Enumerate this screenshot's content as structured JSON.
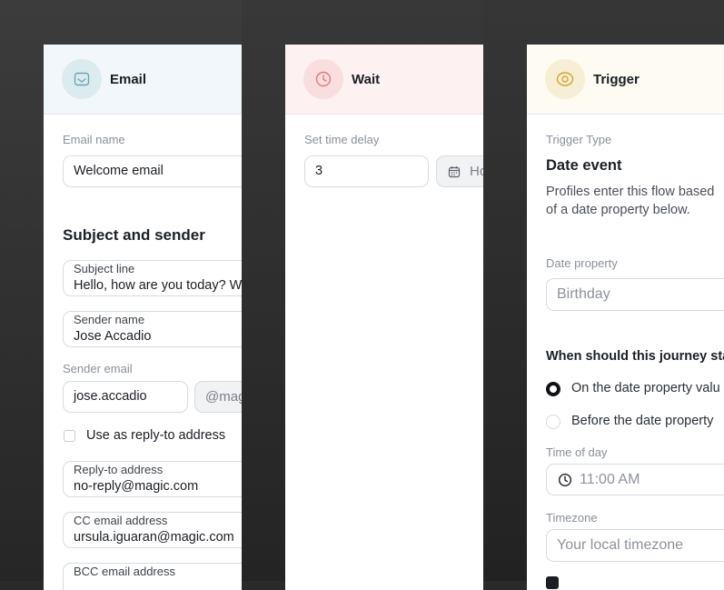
{
  "email_panel": {
    "title": "Email",
    "email_name_label": "Email name",
    "email_name_value": "Welcome email",
    "section_title": "Subject and sender",
    "subject_label": "Subject line",
    "subject_value": "Hello, how are you today? W",
    "sender_name_label": "Sender name",
    "sender_name_value": "Jose Accadio",
    "sender_email_label": "Sender email",
    "sender_email_value": "jose.accadio",
    "sender_domain": "@mag",
    "reply_checkbox_label": "Use as reply-to address",
    "reply_to_label": "Reply-to address",
    "reply_to_value": "no-reply@magic.com",
    "cc_label": "CC email address",
    "cc_value": "ursula.iguaran@magic.com",
    "bcc_label": "BCC email address"
  },
  "wait_panel": {
    "title": "Wait",
    "delay_label": "Set time delay",
    "delay_value": "3",
    "unit_value": "Ho"
  },
  "trigger_panel": {
    "title": "Trigger",
    "type_label": "Trigger Type",
    "type_value": "Date event",
    "description_line1": "Profiles enter this flow based",
    "description_line2": "of a date property below.",
    "date_property_label": "Date property",
    "date_property_placeholder": "Birthday",
    "journey_question": "When should this journey star",
    "option_on_date": "On the date property valu",
    "option_before_date": "Before the date property",
    "time_of_day_label": "Time of day",
    "time_of_day_placeholder": "11:00 AM",
    "timezone_label": "Timezone",
    "timezone_placeholder": "Your local timezone"
  },
  "colors": {
    "email_accent": "#6fa3b5",
    "wait_accent": "#e07b7b",
    "trigger_accent": "#d6a42a"
  }
}
